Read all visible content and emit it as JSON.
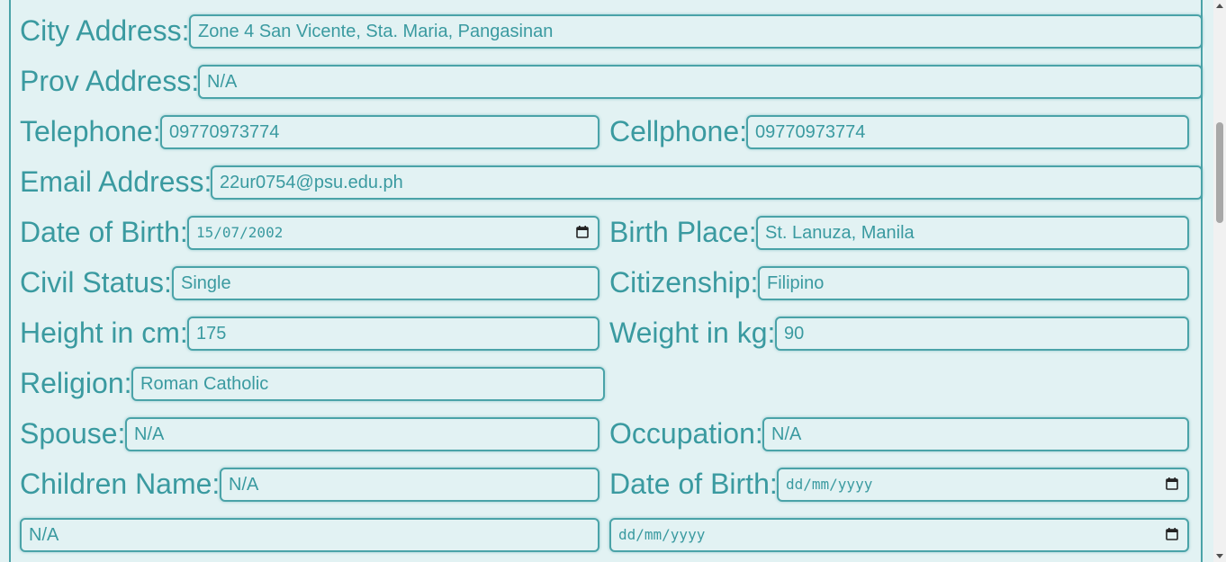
{
  "form": {
    "city_address": {
      "label": "City Address:",
      "value": "Zone 4 San Vicente, Sta. Maria, Pangasinan"
    },
    "prov_address": {
      "label": "Prov Address:",
      "value": "N/A"
    },
    "telephone": {
      "label": "Telephone:",
      "value": "09770973774"
    },
    "cellphone": {
      "label": "Cellphone:",
      "value": "09770973774"
    },
    "email": {
      "label": "Email Address:",
      "value": "22ur0754@psu.edu.ph"
    },
    "date_of_birth": {
      "label": "Date of Birth:",
      "value": "15/07/2002"
    },
    "birth_place": {
      "label": "Birth Place:",
      "value": "St. Lanuza, Manila"
    },
    "civil_status": {
      "label": "Civil Status:",
      "value": "Single"
    },
    "citizenship": {
      "label": "Citizenship:",
      "value": "Filipino"
    },
    "height": {
      "label": "Height in cm:",
      "value": "175"
    },
    "weight": {
      "label": "Weight in kg:",
      "value": "90"
    },
    "religion": {
      "label": "Religion:",
      "value": "Roman Catholic"
    },
    "spouse": {
      "label": "Spouse:",
      "value": "N/A"
    },
    "occupation": {
      "label": "Occupation:",
      "value": "N/A"
    },
    "children_name": {
      "label": "Children Name:",
      "value": "N/A"
    },
    "child_date_of_birth": {
      "label": "Date of Birth:",
      "placeholder": "dd/mm/yyyy"
    },
    "children_name_2": {
      "value": "N/A"
    },
    "child_date_of_birth_2": {
      "placeholder": "dd/mm/yyyy"
    }
  },
  "icons": {
    "calendar": "calendar-icon"
  },
  "colors": {
    "background": "#e2f2f3",
    "accent": "#3a9aa0",
    "border": "#4aa3a8"
  }
}
